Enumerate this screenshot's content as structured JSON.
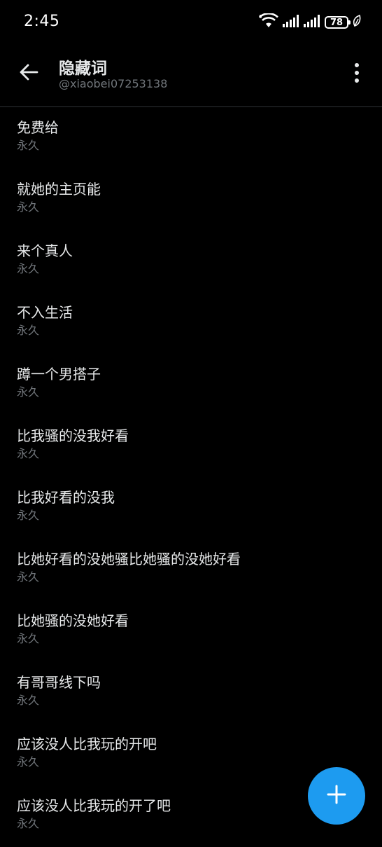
{
  "status_bar": {
    "time": "2:45",
    "battery": "78"
  },
  "header": {
    "title": "隐藏词",
    "subtitle": "@xiaobei07253138"
  },
  "muted_words": [
    {
      "word": "免费给",
      "duration": "永久"
    },
    {
      "word": "就她的主页能",
      "duration": "永久"
    },
    {
      "word": "来个真人",
      "duration": "永久"
    },
    {
      "word": "不入生活",
      "duration": "永久"
    },
    {
      "word": "蹲一个男搭子",
      "duration": "永久"
    },
    {
      "word": "比我骚的没我好看",
      "duration": "永久"
    },
    {
      "word": "比我好看的没我",
      "duration": "永久"
    },
    {
      "word": "比她好看的没她骚比她骚的没她好看",
      "duration": "永久"
    },
    {
      "word": "比她骚的没她好看",
      "duration": "永久"
    },
    {
      "word": "有哥哥线下吗",
      "duration": "永久"
    },
    {
      "word": "应该没人比我玩的开吧",
      "duration": "永久"
    },
    {
      "word": "应该没人比我玩的开了吧",
      "duration": "永久"
    }
  ],
  "colors": {
    "background": "#000000",
    "text_primary": "#e7e9ea",
    "text_secondary": "#71767b",
    "accent": "#1d9bf0"
  },
  "icons": {
    "back": "arrow-left-icon",
    "more": "more-vertical-icon",
    "fab": "plus-icon"
  }
}
